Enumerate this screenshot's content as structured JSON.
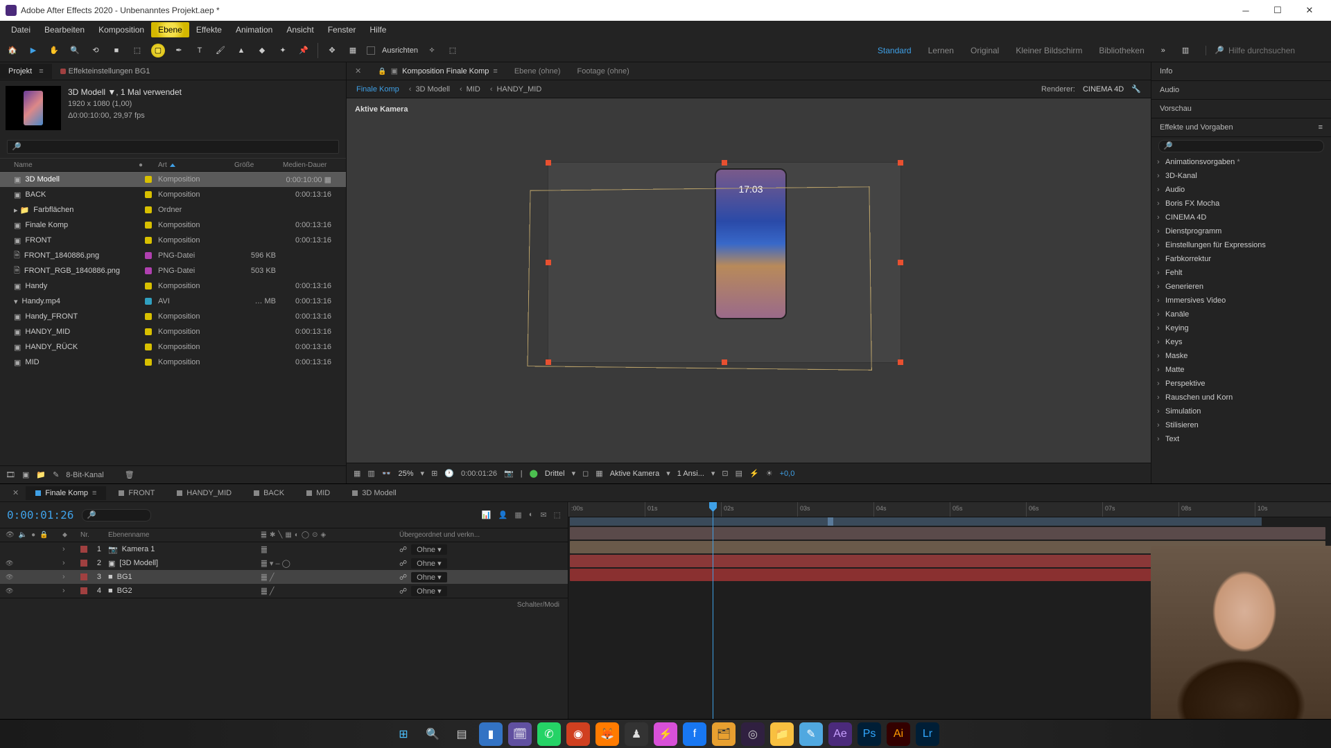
{
  "titlebar": {
    "text": "Adobe After Effects 2020 - Unbenanntes Projekt.aep *"
  },
  "menus": [
    "Datei",
    "Bearbeiten",
    "Komposition",
    "Ebene",
    "Effekte",
    "Animation",
    "Ansicht",
    "Fenster",
    "Hilfe"
  ],
  "menu_highlight_index": 3,
  "toolbar": {
    "align": "Ausrichten"
  },
  "workspaces": {
    "items": [
      "Standard",
      "Lernen",
      "Original",
      "Kleiner Bildschirm",
      "Bibliotheken"
    ],
    "active": 0
  },
  "search_placeholder": "Hilfe durchsuchen",
  "project": {
    "tab1": "Projekt",
    "tab2": "Effekteinstellungen BG1",
    "meta_name": "3D Modell ▼",
    "meta_used": ", 1 Mal verwendet",
    "meta_dim": "1920 x 1080 (1,00)",
    "meta_dur": "Δ0:00:10:00, 29,97 fps",
    "cols": {
      "name": "Name",
      "tag": "●",
      "type": "Art",
      "size": "Größe",
      "dur": "Medien-Dauer"
    },
    "rows": [
      {
        "icon": "comp",
        "name": "3D Modell",
        "color": "#d8c000",
        "type": "Komposition",
        "size": "",
        "dur": "0:00:10:00",
        "sel": true,
        "flag": "▦"
      },
      {
        "icon": "comp",
        "name": "BACK",
        "color": "#d8c000",
        "type": "Komposition",
        "size": "",
        "dur": "0:00:13:16"
      },
      {
        "icon": "folder",
        "name": "Farbflächen",
        "color": "#d8c000",
        "type": "Ordner",
        "size": "",
        "dur": ""
      },
      {
        "icon": "comp",
        "name": "Finale Komp",
        "color": "#d8c000",
        "type": "Komposition",
        "size": "",
        "dur": "0:00:13:16"
      },
      {
        "icon": "comp",
        "name": "FRONT",
        "color": "#d8c000",
        "type": "Komposition",
        "size": "",
        "dur": "0:00:13:16"
      },
      {
        "icon": "file",
        "name": "FRONT_1840886.png",
        "color": "#b040b0",
        "type": "PNG-Datei",
        "size": "596 KB",
        "dur": ""
      },
      {
        "icon": "file",
        "name": "FRONT_RGB_1840886.png",
        "color": "#b040b0",
        "type": "PNG-Datei",
        "size": "503 KB",
        "dur": ""
      },
      {
        "icon": "comp",
        "name": "Handy",
        "color": "#d8c000",
        "type": "Komposition",
        "size": "",
        "dur": "0:00:13:16"
      },
      {
        "icon": "avi",
        "name": "Handy.mp4",
        "color": "#30a0c0",
        "type": "AVI",
        "size": "… MB",
        "dur": "0:00:13:16"
      },
      {
        "icon": "comp",
        "name": "Handy_FRONT",
        "color": "#d8c000",
        "type": "Komposition",
        "size": "",
        "dur": "0:00:13:16"
      },
      {
        "icon": "comp",
        "name": "HANDY_MID",
        "color": "#d8c000",
        "type": "Komposition",
        "size": "",
        "dur": "0:00:13:16"
      },
      {
        "icon": "comp",
        "name": "HANDY_RÜCK",
        "color": "#d8c000",
        "type": "Komposition",
        "size": "",
        "dur": "0:00:13:16"
      },
      {
        "icon": "comp",
        "name": "MID",
        "color": "#d8c000",
        "type": "Komposition",
        "size": "",
        "dur": "0:00:13:16"
      }
    ],
    "footer": "8-Bit-Kanal"
  },
  "comp": {
    "tabs": [
      "Komposition Finale Komp",
      "Ebene (ohne)",
      "Footage (ohne)"
    ],
    "breadcrumb": [
      "Finale Komp",
      "3D Modell",
      "MID",
      "HANDY_MID"
    ],
    "renderer_label": "Renderer:",
    "renderer": "CINEMA 4D",
    "active_cam": "Aktive Kamera",
    "phone_clock": "17:03"
  },
  "viewer_footer": {
    "zoom": "25%",
    "tc": "0:00:01:26",
    "res": "Drittel",
    "cam": "Aktive Kamera",
    "views": "1 Ansi...",
    "exposure": "+0,0"
  },
  "right_panels": [
    "Info",
    "Audio",
    "Vorschau"
  ],
  "effects_title": "Effekte und Vorgaben",
  "effects": [
    {
      "name": "Animationsvorgaben",
      "star": true
    },
    {
      "name": "3D-Kanal"
    },
    {
      "name": "Audio"
    },
    {
      "name": "Boris FX Mocha"
    },
    {
      "name": "CINEMA 4D"
    },
    {
      "name": "Dienstprogramm"
    },
    {
      "name": "Einstellungen für Expressions"
    },
    {
      "name": "Farbkorrektur"
    },
    {
      "name": "Fehlt"
    },
    {
      "name": "Generieren"
    },
    {
      "name": "Immersives Video"
    },
    {
      "name": "Kanäle"
    },
    {
      "name": "Keying"
    },
    {
      "name": "Keys"
    },
    {
      "name": "Maske"
    },
    {
      "name": "Matte"
    },
    {
      "name": "Perspektive"
    },
    {
      "name": "Rauschen und Korn"
    },
    {
      "name": "Simulation"
    },
    {
      "name": "Stilisieren"
    },
    {
      "name": "Text"
    }
  ],
  "timeline": {
    "tabs": [
      "Finale Komp",
      "FRONT",
      "HANDY_MID",
      "BACK",
      "MID",
      "3D Modell"
    ],
    "active_tab": 0,
    "timecode": "0:00:01:26",
    "cols": {
      "nr": "Nr.",
      "layer": "Ebenenname",
      "parent": "Übergeordnet und verkn..."
    },
    "ticks": [
      ":00s",
      "01s",
      "02s",
      "03s",
      "04s",
      "05s",
      "06s",
      "07s",
      "08s",
      "10s"
    ],
    "layers": [
      {
        "eye": false,
        "nr": "1",
        "color": "#a04040",
        "icon": "📷",
        "name": "Kamera 1",
        "parent": "Ohne",
        "mode": "䷀"
      },
      {
        "eye": true,
        "nr": "2",
        "color": "#a04040",
        "icon": "▣",
        "name": "[3D Modell]",
        "parent": "Ohne",
        "mode": "䷀ ▾  –   ◯"
      },
      {
        "eye": true,
        "nr": "3",
        "color": "#a04040",
        "icon": "■",
        "name": "BG1",
        "parent": "Ohne",
        "mode": "䷀    ╱",
        "sel": true
      },
      {
        "eye": true,
        "nr": "4",
        "color": "#a04040",
        "icon": "■",
        "name": "BG2",
        "parent": "Ohne",
        "mode": "䷀    ╱"
      }
    ],
    "footer": "Schalter/Modi"
  },
  "taskbar": [
    {
      "bg": "transparent",
      "glyph": "⊞",
      "color": "#4cc2ff"
    },
    {
      "bg": "transparent",
      "glyph": "🔍",
      "color": "#fff"
    },
    {
      "bg": "transparent",
      "glyph": "▤",
      "color": "#ccc"
    },
    {
      "bg": "#3373c4",
      "glyph": "▮",
      "color": "#fff"
    },
    {
      "bg": "#6050a0",
      "glyph": "🗓",
      "color": "#fff"
    },
    {
      "bg": "#25d366",
      "glyph": "✆",
      "color": "#fff"
    },
    {
      "bg": "#d04020",
      "glyph": "◉",
      "color": "#fff"
    },
    {
      "bg": "#ff7b00",
      "glyph": "🦊",
      "color": "#fff"
    },
    {
      "bg": "#333",
      "glyph": "♟",
      "color": "#ddd"
    },
    {
      "bg": "#d850d8",
      "glyph": "⚡",
      "color": "#fff"
    },
    {
      "bg": "#1877f2",
      "glyph": "f",
      "color": "#fff"
    },
    {
      "bg": "#e8a030",
      "glyph": "🗂",
      "color": "#333"
    },
    {
      "bg": "#302040",
      "glyph": "◎",
      "color": "#ccc"
    },
    {
      "bg": "#f8c040",
      "glyph": "📁",
      "color": "#333"
    },
    {
      "bg": "#50a8e0",
      "glyph": "✎",
      "color": "#fff"
    },
    {
      "bg": "#4b2a7b",
      "glyph": "Ae",
      "color": "#c8a0ff"
    },
    {
      "bg": "#001e36",
      "glyph": "Ps",
      "color": "#31a8ff"
    },
    {
      "bg": "#330000",
      "glyph": "Ai",
      "color": "#ff9a00"
    },
    {
      "bg": "#001e36",
      "glyph": "Lr",
      "color": "#31a8ff"
    }
  ]
}
